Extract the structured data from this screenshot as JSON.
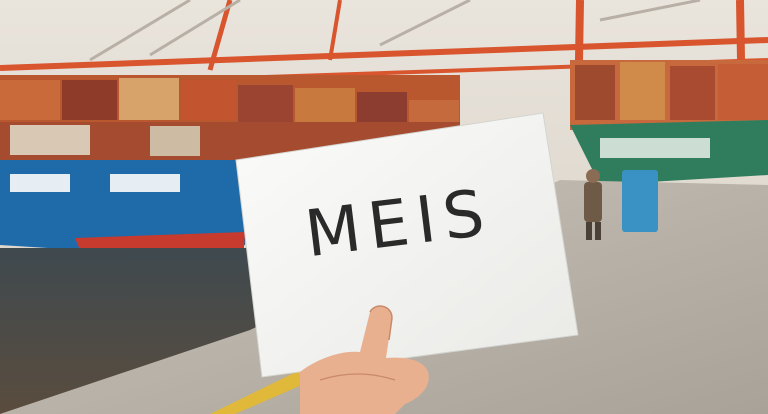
{
  "sign": {
    "text": "MEIS"
  },
  "colors": {
    "sky": "#e6e0d6",
    "crane": "#d8552e",
    "ship_hull_blue": "#1f6aa8",
    "ship_hull_green": "#2f7d5c",
    "paper": "#f4f4f2",
    "ink": "#2a2a2a",
    "skin": "#e8b08f"
  }
}
